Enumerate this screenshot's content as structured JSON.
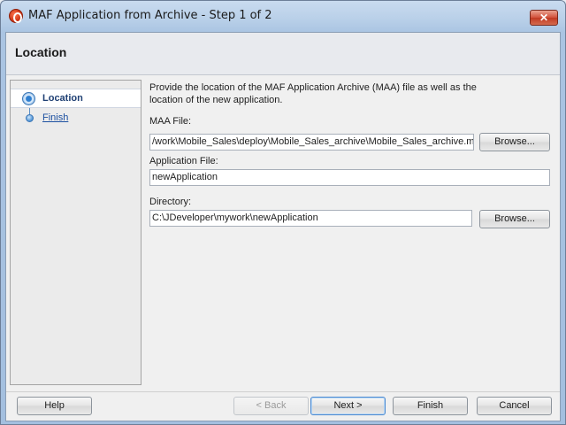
{
  "window": {
    "title": "MAF Application from Archive - Step 1 of 2",
    "close_symbol": "✕"
  },
  "header": {
    "title": "Location"
  },
  "nav": {
    "items": [
      {
        "label": "Location",
        "selected": true
      },
      {
        "label": "Finish",
        "selected": false
      }
    ]
  },
  "main": {
    "description": "Provide the location of the MAF Application Archive (MAA) file as well as the location of the new application.",
    "maa_file": {
      "label": "MAA File:",
      "value": "/work\\Mobile_Sales\\deploy\\Mobile_Sales_archive\\Mobile_Sales_archive.maa",
      "browse_label": "Browse..."
    },
    "application_file": {
      "label": "Application File:",
      "value": "newApplication"
    },
    "directory": {
      "label": "Directory:",
      "value": "C:\\JDeveloper\\mywork\\newApplication",
      "browse_label": "Browse..."
    }
  },
  "footer": {
    "help": "Help",
    "back": "< Back",
    "next": "Next >",
    "finish": "Finish",
    "cancel": "Cancel"
  },
  "icons": {
    "app": "jdeveloper-app-icon",
    "close": "close-icon",
    "step_current": "step-current-icon",
    "step_pending": "step-pending-icon"
  }
}
